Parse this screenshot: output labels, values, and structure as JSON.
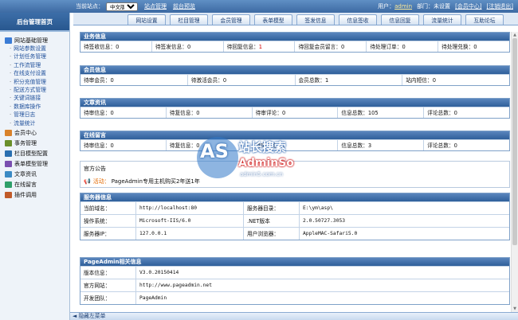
{
  "topbar": {
    "site_label": "当前站点：",
    "site_value": "中文版",
    "link_site_manage": "站点管理",
    "link_preview": "前台预览",
    "user_label": "用户：",
    "user_name": "admin",
    "dept_label": "部门：未设置",
    "member_center": "[会员中心]",
    "logout": "[注销退出]"
  },
  "sidebar": {
    "title": "后台管理首页",
    "groups": [
      {
        "label": "网站基础管理",
        "icon": "folder-icon",
        "color": "#3a7bd5",
        "items": [
          "网站参数设置",
          "计划任务管理",
          "工作流管理",
          "在线支付设置",
          "积分充值管理",
          "配送方式管理",
          "关键词链接",
          "数据库操作",
          "管理日志",
          "流量统计"
        ]
      },
      {
        "label": "会员中心",
        "icon": "users-icon",
        "color": "#d9822b",
        "items": []
      },
      {
        "label": "事务管理",
        "icon": "task-icon",
        "color": "#6a8f2a",
        "items": []
      },
      {
        "label": "栏目模型配置",
        "icon": "grid-icon",
        "color": "#2a6fb0",
        "items": []
      },
      {
        "label": "表单模型管理",
        "icon": "form-icon",
        "color": "#7a4fb0",
        "items": []
      },
      {
        "label": "文章资讯",
        "icon": "doc-icon",
        "color": "#3b8ac4",
        "items": []
      },
      {
        "label": "在线留言",
        "icon": "chat-icon",
        "color": "#2f9f6a",
        "items": []
      },
      {
        "label": "插件调用",
        "icon": "plugin-icon",
        "color": "#c05a2a",
        "items": []
      }
    ]
  },
  "tabs": [
    "网站设置",
    "栏目管理",
    "会员管理",
    "表单模型",
    "签发信息",
    "信息签收",
    "信息回复",
    "流量统计",
    "互助论坛"
  ],
  "sections": {
    "business": {
      "title": "业务信息",
      "cells": [
        {
          "label": "待签收信息：",
          "value": "0"
        },
        {
          "label": "待签发信息：",
          "value": "0"
        },
        {
          "label": "待回复信息：",
          "value": "1",
          "highlight": true
        },
        {
          "label": "待回复会员留言：",
          "value": "0"
        },
        {
          "label": "待处理订单：",
          "value": "0"
        },
        {
          "label": "待处理兑换：",
          "value": "0"
        }
      ]
    },
    "members": {
      "title": "会员信息",
      "cells": [
        {
          "label": "待审会员：",
          "value": "0"
        },
        {
          "label": "待激活会员：",
          "value": "0"
        },
        {
          "label": "会员总数：",
          "value": "1"
        },
        {
          "label": "站内短信：",
          "value": "0"
        }
      ]
    },
    "articles": {
      "title": "文章资讯",
      "cells": [
        {
          "label": "待审信息：",
          "value": "0"
        },
        {
          "label": "待复信息：",
          "value": "0"
        },
        {
          "label": "待审评论：",
          "value": "0"
        },
        {
          "label": "信息总数：",
          "value": "105"
        },
        {
          "label": "评论总数：",
          "value": "0"
        }
      ]
    },
    "messages": {
      "title": "在线留言",
      "cells": [
        {
          "label": "待审信息：",
          "value": "0"
        },
        {
          "label": "待复信息：",
          "value": "0"
        },
        {
          "label": "待审评论：",
          "value": "0"
        },
        {
          "label": "信息总数：",
          "value": "3"
        },
        {
          "label": "评论总数：",
          "value": "0"
        }
      ]
    },
    "notice": {
      "title": "官方公告",
      "tag": "活动：",
      "text": "PageAdmin专用主机购买2年送1年"
    },
    "server": {
      "title": "服务器信息",
      "rows": [
        {
          "k1": "当前域名：",
          "v1": "http://localhost:80",
          "k2": "服务器目录：",
          "v2": "E:\\ym\\asp\\"
        },
        {
          "k1": "操作系统：",
          "v1": "Microsoft-IIS/6.0",
          "k2": ".NET版本",
          "v2": "2.0.50727.3053"
        },
        {
          "k1": "服务器IP：",
          "v1": "127.0.0.1",
          "k2": "用户浏览器：",
          "v2": "AppleMAC-Safari5.0"
        }
      ]
    },
    "pageadmin": {
      "title": "PageAdmin相关信息",
      "rows": [
        {
          "k": "版本信息：",
          "v": "V3.0.20150414"
        },
        {
          "k": "官方网站：",
          "v": "http://www.pageadmin.net"
        },
        {
          "k": "开发团队：",
          "v": "PageAdmin"
        }
      ]
    }
  },
  "bottombar": {
    "label": "◄ 隐藏左菜单"
  },
  "watermark": {
    "as": "AS",
    "cn": "站长搜索",
    "ad": "AdminSo",
    "url": "admin5.com.cn"
  }
}
